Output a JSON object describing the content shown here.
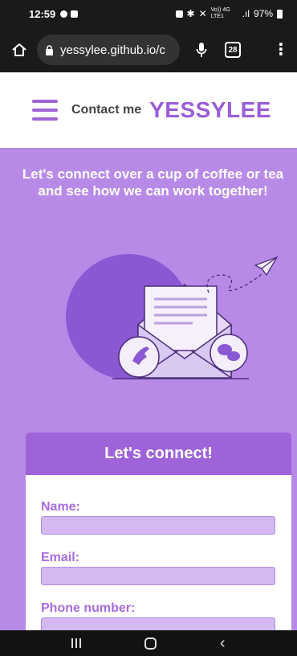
{
  "status_bar": {
    "time": "12:59",
    "network": "Vo)) 4G LTE1",
    "battery": "97%"
  },
  "browser": {
    "url": "yessylee.github.io/c",
    "tab_count": "28"
  },
  "header": {
    "nav_link": "Contact me",
    "logo": "YESSYLEE"
  },
  "hero": {
    "text": "Let's connect over a cup of coffee or tea and see how we can work together!"
  },
  "form": {
    "title": "Let's connect!",
    "fields": [
      {
        "label": "Name:",
        "value": ""
      },
      {
        "label": "Email:",
        "value": ""
      },
      {
        "label": "Phone number:",
        "value": ""
      }
    ]
  },
  "colors": {
    "accent": "#9a5cd7",
    "hero_bg": "#b88ae8",
    "card_header": "#9e63d8",
    "input_bg": "#d3b9ef"
  },
  "icons": [
    "home-icon",
    "lock-icon",
    "mic-icon",
    "tabs-icon",
    "more-icon",
    "hamburger-icon",
    "envelope-illustration",
    "phone-icon",
    "chat-icon",
    "paper-plane-icon",
    "recent-apps-icon",
    "home-button-icon",
    "back-icon"
  ]
}
